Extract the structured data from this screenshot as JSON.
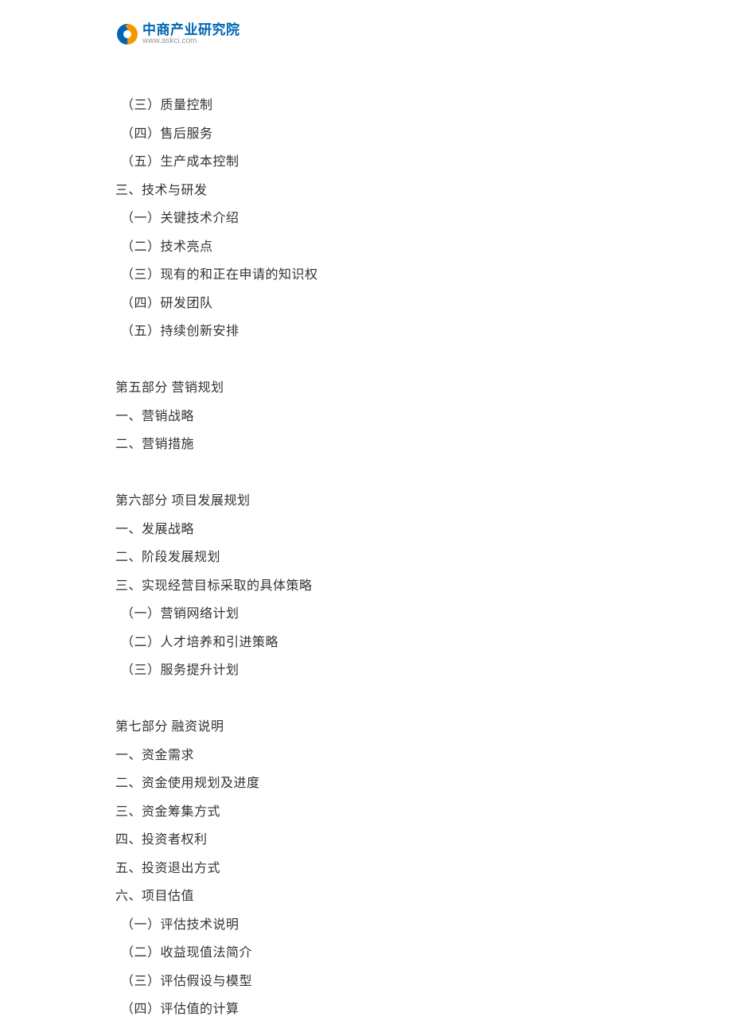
{
  "logo": {
    "title": "中商产业研究院",
    "url": "www.askci.com"
  },
  "lines": [
    {
      "text": "（三）质量控制",
      "sub": true
    },
    {
      "text": "（四）售后服务",
      "sub": true
    },
    {
      "text": "（五）生产成本控制",
      "sub": true
    },
    {
      "text": "三、技术与研发",
      "sub": false
    },
    {
      "text": "（一）关键技术介绍",
      "sub": true
    },
    {
      "text": "（二）技术亮点",
      "sub": true
    },
    {
      "text": "（三）现有的和正在申请的知识权",
      "sub": true
    },
    {
      "text": "（四）研发团队",
      "sub": true
    },
    {
      "text": "（五）持续创新安排",
      "sub": true
    },
    {
      "spacer": true
    },
    {
      "text": "第五部分  营销规划",
      "sub": false
    },
    {
      "text": "一、营销战略",
      "sub": false
    },
    {
      "text": "二、营销措施",
      "sub": false
    },
    {
      "spacer": true
    },
    {
      "text": "第六部分  项目发展规划",
      "sub": false
    },
    {
      "text": "一、发展战略",
      "sub": false
    },
    {
      "text": "二、阶段发展规划",
      "sub": false
    },
    {
      "text": "三、实现经营目标采取的具体策略",
      "sub": false
    },
    {
      "text": "（一）营销网络计划",
      "sub": true
    },
    {
      "text": "（二）人才培养和引进策略",
      "sub": true
    },
    {
      "text": "（三）服务提升计划",
      "sub": true
    },
    {
      "spacer": true
    },
    {
      "text": "第七部分  融资说明",
      "sub": false
    },
    {
      "text": "一、资金需求",
      "sub": false
    },
    {
      "text": "二、资金使用规划及进度",
      "sub": false
    },
    {
      "text": "三、资金筹集方式",
      "sub": false
    },
    {
      "text": "四、投资者权利",
      "sub": false
    },
    {
      "text": "五、投资退出方式",
      "sub": false
    },
    {
      "text": "六、项目估值",
      "sub": false
    },
    {
      "text": "（一）评估技术说明",
      "sub": true
    },
    {
      "text": "（二）收益现值法简介",
      "sub": true
    },
    {
      "text": "（三）评估假设与模型",
      "sub": true
    },
    {
      "text": "（四）评估值的计算",
      "sub": true
    }
  ]
}
